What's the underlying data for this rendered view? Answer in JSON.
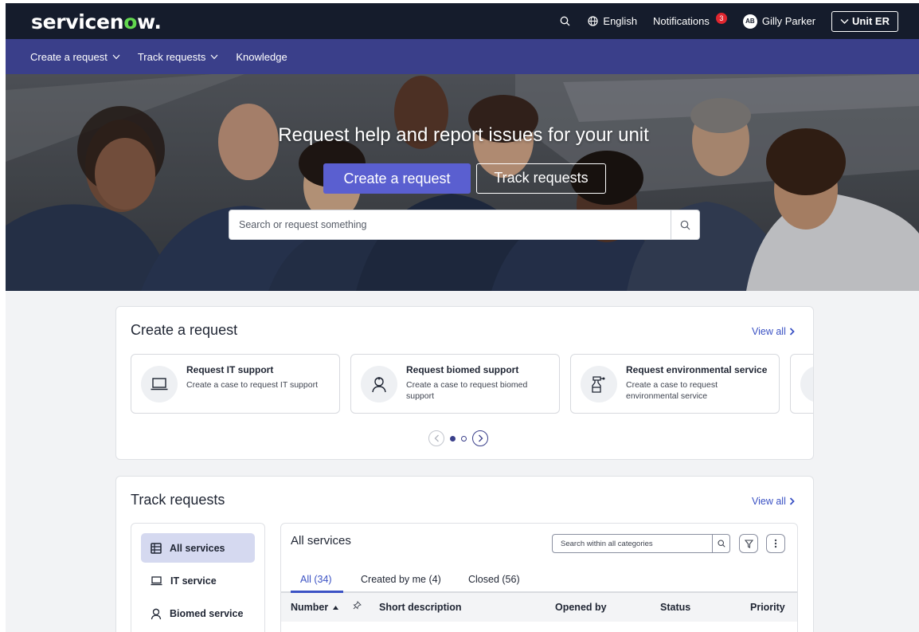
{
  "header": {
    "logo": {
      "before": "servicen",
      "o": "o",
      "after": "w",
      "dot": "."
    },
    "language": "English",
    "notifications_label": "Notifications",
    "notifications_count": "3",
    "user_initials": "AB",
    "user_name": "Gilly Parker",
    "unit_label": "Unit ER"
  },
  "nav": {
    "items": [
      {
        "label": "Create a request",
        "has_dropdown": true
      },
      {
        "label": "Track requests",
        "has_dropdown": true
      },
      {
        "label": "Knowledge",
        "has_dropdown": false
      }
    ]
  },
  "hero": {
    "title": "Request help and report issues for your unit",
    "primary_button": "Create a request",
    "secondary_button": "Track requests",
    "search_placeholder": "Search or request something"
  },
  "create_card": {
    "title": "Create a request",
    "view_all": "View all",
    "tiles": [
      {
        "name": "Request IT support",
        "desc": "Create a case to request IT support",
        "icon": "laptop-icon"
      },
      {
        "name": "Request biomed support",
        "desc": "Create a case to request biomed support",
        "icon": "medical-worker-icon"
      },
      {
        "name": "Request environmental service",
        "desc": "Create a case to request environmental service",
        "icon": "spray-bottle-icon"
      }
    ],
    "carousel": {
      "pages": 2,
      "active": 0
    }
  },
  "track_card": {
    "title": "Track requests",
    "view_all": "View all",
    "side_items": [
      {
        "label": "All services",
        "icon": "list-icon",
        "active": true
      },
      {
        "label": "IT service",
        "icon": "laptop-icon",
        "active": false
      },
      {
        "label": "Biomed service",
        "icon": "medical-worker-icon",
        "active": false
      }
    ],
    "panel": {
      "title": "All services",
      "search_placeholder": "Search within all categories",
      "tabs": [
        {
          "label": "All (34)",
          "active": true
        },
        {
          "label": "Created by me (4)",
          "active": false
        },
        {
          "label": "Closed (56)",
          "active": false
        }
      ],
      "columns": [
        "Number",
        "Short description",
        "Opened by",
        "Status",
        "Priority"
      ]
    }
  },
  "colors": {
    "header_bg": "#151c2c",
    "nav_bg": "#3a3f8a",
    "primary": "#5a5fd0",
    "link": "#3b52c4",
    "logo_accent": "#62d84e",
    "badge": "#e0262f"
  }
}
